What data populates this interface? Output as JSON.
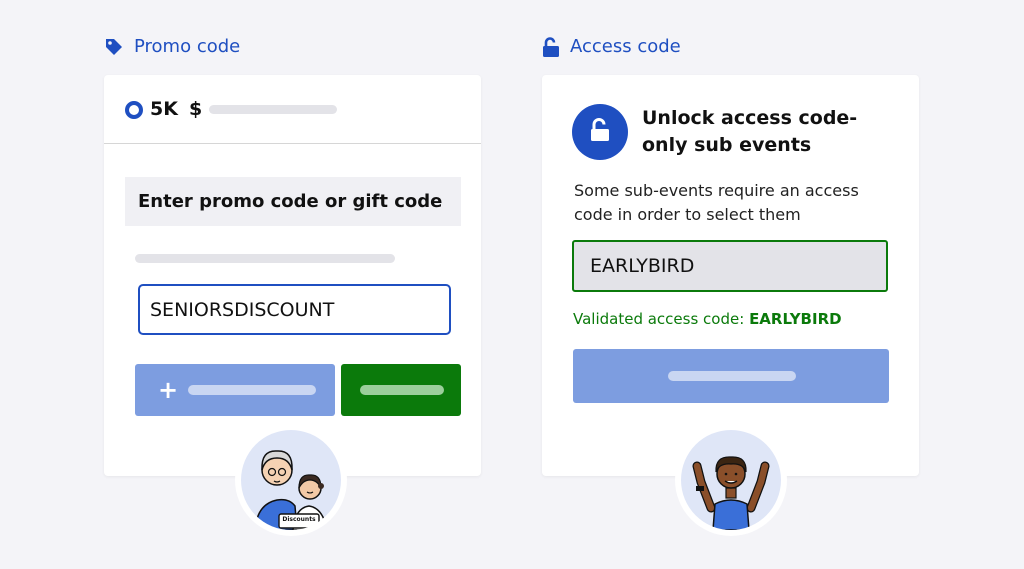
{
  "promo_section": {
    "title": "Promo code",
    "icon": "tag-icon",
    "ticket": {
      "name": "5K",
      "currency": "$"
    },
    "header": "Enter promo code or gift code",
    "input_value": "SENIORSDISCOUNT",
    "add_symbol": "+",
    "badge_text": "Discounts"
  },
  "access_section": {
    "title": "Access code",
    "icon": "unlock-icon",
    "heading": "Unlock access code-only sub events",
    "description": "Some sub-events require an access code in order to select them",
    "input_value": "EARLYBIRD",
    "validated_label": "Validated access code:",
    "validated_code": "EARLYBIRD"
  },
  "colors": {
    "accent_blue": "#1f4fc1",
    "success_green": "#0b7a0b",
    "button_light_blue": "#7d9de0",
    "background": "#f4f4f8"
  }
}
